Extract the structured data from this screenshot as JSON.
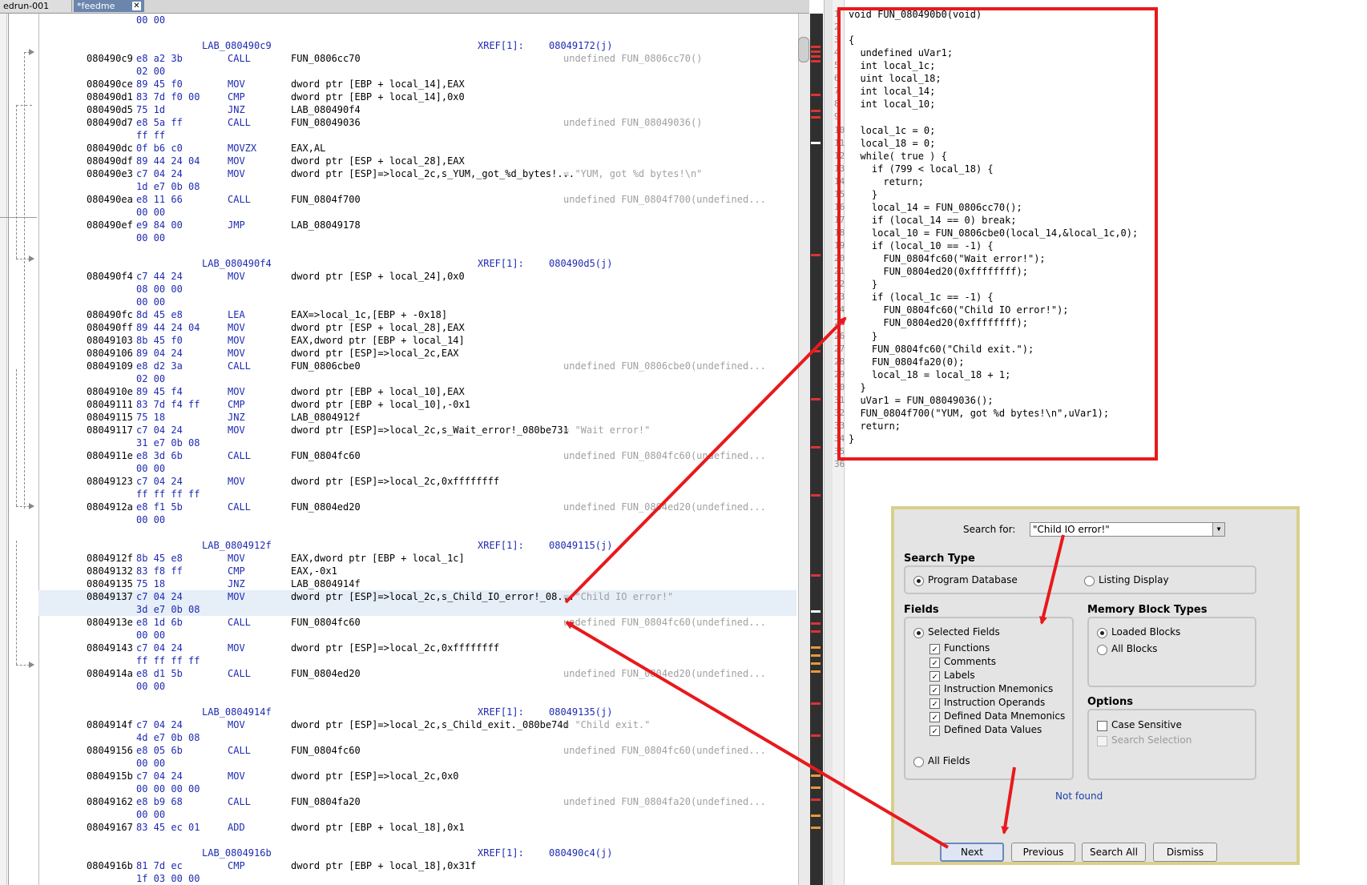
{
  "tabs": [
    {
      "label": "edrun-001"
    },
    {
      "label": "*feedme"
    }
  ],
  "listing": {
    "rows": [
      {
        "t": "cont",
        "bytes": "00 00"
      },
      {
        "t": "blank"
      },
      {
        "t": "label",
        "label": "LAB_080490c9",
        "xref": "XREF[1]:",
        "xaddr": "08049172(j)"
      },
      {
        "t": "ins",
        "addr": "080490c9",
        "bytes": "e8 a2 3b",
        "mn": "CALL",
        "ops": "FUN_0806cc70",
        "cmt": "undefined FUN_0806cc70()"
      },
      {
        "t": "cont",
        "bytes": "02 00"
      },
      {
        "t": "ins",
        "addr": "080490ce",
        "bytes": "89 45 f0",
        "mn": "MOV",
        "ops": "dword ptr [EBP + local_14],EAX",
        "cmt": ""
      },
      {
        "t": "ins",
        "addr": "080490d1",
        "bytes": "83 7d f0 00",
        "mn": "CMP",
        "ops": "dword ptr [EBP + local_14],0x0",
        "cmt": ""
      },
      {
        "t": "ins",
        "addr": "080490d5",
        "bytes": "75 1d",
        "mn": "JNZ",
        "ops": "LAB_080490f4",
        "cmt": ""
      },
      {
        "t": "ins",
        "addr": "080490d7",
        "bytes": "e8 5a ff",
        "mn": "CALL",
        "ops": "FUN_08049036",
        "cmt": "undefined FUN_08049036()"
      },
      {
        "t": "cont",
        "bytes": "ff ff"
      },
      {
        "t": "ins",
        "addr": "080490dc",
        "bytes": "0f b6 c0",
        "mn": "MOVZX",
        "ops": "EAX,AL",
        "cmt": ""
      },
      {
        "t": "ins",
        "addr": "080490df",
        "bytes": "89 44 24 04",
        "mn": "MOV",
        "ops": "dword ptr [ESP + local_28],EAX",
        "cmt": ""
      },
      {
        "t": "ins",
        "addr": "080490e3",
        "bytes": "c7 04 24",
        "mn": "MOV",
        "ops": "dword ptr [ESP]=>local_2c,s_YUM,_got_%d_bytes!...",
        "cmt": "= \"YUM, got %d bytes!\\n\""
      },
      {
        "t": "cont",
        "bytes": "1d e7 0b 08"
      },
      {
        "t": "ins",
        "addr": "080490ea",
        "bytes": "e8 11 66",
        "mn": "CALL",
        "ops": "FUN_0804f700",
        "cmt": "undefined FUN_0804f700(undefined..."
      },
      {
        "t": "cont",
        "bytes": "00 00"
      },
      {
        "t": "ins",
        "addr": "080490ef",
        "bytes": "e9 84 00",
        "mn": "JMP",
        "ops": "LAB_08049178",
        "cmt": ""
      },
      {
        "t": "cont",
        "bytes": "00 00"
      },
      {
        "t": "blank"
      },
      {
        "t": "label",
        "label": "LAB_080490f4",
        "xref": "XREF[1]:",
        "xaddr": "080490d5(j)"
      },
      {
        "t": "ins",
        "addr": "080490f4",
        "bytes": "c7 44 24",
        "mn": "MOV",
        "ops": "dword ptr [ESP + local_24],0x0",
        "cmt": ""
      },
      {
        "t": "cont",
        "bytes": "08 00 00"
      },
      {
        "t": "cont",
        "bytes": "00 00"
      },
      {
        "t": "ins",
        "addr": "080490fc",
        "bytes": "8d 45 e8",
        "mn": "LEA",
        "ops": "EAX=>local_1c,[EBP + -0x18]",
        "cmt": ""
      },
      {
        "t": "ins",
        "addr": "080490ff",
        "bytes": "89 44 24 04",
        "mn": "MOV",
        "ops": "dword ptr [ESP + local_28],EAX",
        "cmt": ""
      },
      {
        "t": "ins",
        "addr": "08049103",
        "bytes": "8b 45 f0",
        "mn": "MOV",
        "ops": "EAX,dword ptr [EBP + local_14]",
        "cmt": ""
      },
      {
        "t": "ins",
        "addr": "08049106",
        "bytes": "89 04 24",
        "mn": "MOV",
        "ops": "dword ptr [ESP]=>local_2c,EAX",
        "cmt": ""
      },
      {
        "t": "ins",
        "addr": "08049109",
        "bytes": "e8 d2 3a",
        "mn": "CALL",
        "ops": "FUN_0806cbe0",
        "cmt": "undefined FUN_0806cbe0(undefined..."
      },
      {
        "t": "cont",
        "bytes": "02 00"
      },
      {
        "t": "ins",
        "addr": "0804910e",
        "bytes": "89 45 f4",
        "mn": "MOV",
        "ops": "dword ptr [EBP + local_10],EAX",
        "cmt": ""
      },
      {
        "t": "ins",
        "addr": "08049111",
        "bytes": "83 7d f4 ff",
        "mn": "CMP",
        "ops": "dword ptr [EBP + local_10],-0x1",
        "cmt": ""
      },
      {
        "t": "ins",
        "addr": "08049115",
        "bytes": "75 18",
        "mn": "JNZ",
        "ops": "LAB_0804912f",
        "cmt": ""
      },
      {
        "t": "ins",
        "addr": "08049117",
        "bytes": "c7 04 24",
        "mn": "MOV",
        "ops": "dword ptr [ESP]=>local_2c,s_Wait_error!_080be731",
        "cmt": "= \"Wait error!\""
      },
      {
        "t": "cont",
        "bytes": "31 e7 0b 08"
      },
      {
        "t": "ins",
        "addr": "0804911e",
        "bytes": "e8 3d 6b",
        "mn": "CALL",
        "ops": "FUN_0804fc60",
        "cmt": "undefined FUN_0804fc60(undefined..."
      },
      {
        "t": "cont",
        "bytes": "00 00"
      },
      {
        "t": "ins",
        "addr": "08049123",
        "bytes": "c7 04 24",
        "mn": "MOV",
        "ops": "dword ptr [ESP]=>local_2c,0xffffffff",
        "cmt": ""
      },
      {
        "t": "cont",
        "bytes": "ff ff ff ff"
      },
      {
        "t": "ins",
        "addr": "0804912a",
        "bytes": "e8 f1 5b",
        "mn": "CALL",
        "ops": "FUN_0804ed20",
        "cmt": "undefined FUN_0804ed20(undefined..."
      },
      {
        "t": "cont",
        "bytes": "00 00"
      },
      {
        "t": "blank"
      },
      {
        "t": "label",
        "label": "LAB_0804912f",
        "xref": "XREF[1]:",
        "xaddr": "08049115(j)"
      },
      {
        "t": "ins",
        "addr": "0804912f",
        "bytes": "8b 45 e8",
        "mn": "MOV",
        "ops": "EAX,dword ptr [EBP + local_1c]",
        "cmt": ""
      },
      {
        "t": "ins",
        "addr": "08049132",
        "bytes": "83 f8 ff",
        "mn": "CMP",
        "ops": "EAX,-0x1",
        "cmt": ""
      },
      {
        "t": "ins",
        "addr": "08049135",
        "bytes": "75 18",
        "mn": "JNZ",
        "ops": "LAB_0804914f",
        "cmt": ""
      },
      {
        "t": "ins",
        "addr": "08049137",
        "bytes": "c7 04 24",
        "mn": "MOV",
        "ops": "dword ptr [ESP]=>local_2c,s_Child_IO_error!_08...",
        "cmt": "= \"Child IO error!\"",
        "hl": true
      },
      {
        "t": "cont",
        "bytes": "3d e7 0b 08"
      },
      {
        "t": "ins",
        "addr": "0804913e",
        "bytes": "e8 1d 6b",
        "mn": "CALL",
        "ops": "FUN_0804fc60",
        "cmt": "undefined FUN_0804fc60(undefined..."
      },
      {
        "t": "cont",
        "bytes": "00 00"
      },
      {
        "t": "ins",
        "addr": "08049143",
        "bytes": "c7 04 24",
        "mn": "MOV",
        "ops": "dword ptr [ESP]=>local_2c,0xffffffff",
        "cmt": ""
      },
      {
        "t": "cont",
        "bytes": "ff ff ff ff"
      },
      {
        "t": "ins",
        "addr": "0804914a",
        "bytes": "e8 d1 5b",
        "mn": "CALL",
        "ops": "FUN_0804ed20",
        "cmt": "undefined FUN_0804ed20(undefined..."
      },
      {
        "t": "cont",
        "bytes": "00 00"
      },
      {
        "t": "blank"
      },
      {
        "t": "label",
        "label": "LAB_0804914f",
        "xref": "XREF[1]:",
        "xaddr": "08049135(j)"
      },
      {
        "t": "ins",
        "addr": "0804914f",
        "bytes": "c7 04 24",
        "mn": "MOV",
        "ops": "dword ptr [ESP]=>local_2c,s_Child_exit._080be74d",
        "cmt": "= \"Child exit.\""
      },
      {
        "t": "cont",
        "bytes": "4d e7 0b 08"
      },
      {
        "t": "ins",
        "addr": "08049156",
        "bytes": "e8 05 6b",
        "mn": "CALL",
        "ops": "FUN_0804fc60",
        "cmt": "undefined FUN_0804fc60(undefined..."
      },
      {
        "t": "cont",
        "bytes": "00 00"
      },
      {
        "t": "ins",
        "addr": "0804915b",
        "bytes": "c7 04 24",
        "mn": "MOV",
        "ops": "dword ptr [ESP]=>local_2c,0x0",
        "cmt": ""
      },
      {
        "t": "cont",
        "bytes": "00 00 00 00"
      },
      {
        "t": "ins",
        "addr": "08049162",
        "bytes": "e8 b9 68",
        "mn": "CALL",
        "ops": "FUN_0804fa20",
        "cmt": "undefined FUN_0804fa20(undefined..."
      },
      {
        "t": "cont",
        "bytes": "00 00"
      },
      {
        "t": "ins",
        "addr": "08049167",
        "bytes": "83 45 ec 01",
        "mn": "ADD",
        "ops": "dword ptr [EBP + local_18],0x1",
        "cmt": ""
      },
      {
        "t": "blank"
      },
      {
        "t": "label",
        "label": "LAB_0804916b",
        "xref": "XREF[1]:",
        "xaddr": "080490c4(j)"
      },
      {
        "t": "ins",
        "addr": "0804916b",
        "bytes": "81 7d ec",
        "mn": "CMP",
        "ops": "dword ptr [EBP + local_18],0x31f",
        "cmt": ""
      },
      {
        "t": "cont",
        "bytes": "1f 03 00 00"
      }
    ]
  },
  "decompiler": {
    "lines": [
      {
        "n": "1",
        "code": "void FUN_080490b0(void)"
      },
      {
        "n": "2",
        "code": ""
      },
      {
        "n": "3",
        "code": "{"
      },
      {
        "n": "4",
        "code": "  undefined uVar1;"
      },
      {
        "n": "5",
        "code": "  int local_1c;"
      },
      {
        "n": "6",
        "code": "  uint local_18;"
      },
      {
        "n": "7",
        "code": "  int local_14;"
      },
      {
        "n": "8",
        "code": "  int local_10;"
      },
      {
        "n": "9",
        "code": ""
      },
      {
        "n": "10",
        "code": "  local_1c = 0;"
      },
      {
        "n": "11",
        "code": "  local_18 = 0;"
      },
      {
        "n": "12",
        "code": "  while( true ) {"
      },
      {
        "n": "13",
        "code": "    if (799 < local_18) {"
      },
      {
        "n": "14",
        "code": "      return;"
      },
      {
        "n": "15",
        "code": "    }"
      },
      {
        "n": "16",
        "code": "    local_14 = FUN_0806cc70();"
      },
      {
        "n": "17",
        "code": "    if (local_14 == 0) break;"
      },
      {
        "n": "18",
        "code": "    local_10 = FUN_0806cbe0(local_14,&local_1c,0);"
      },
      {
        "n": "19",
        "code": "    if (local_10 == -1) {"
      },
      {
        "n": "20",
        "code": "      FUN_0804fc60(\"Wait error!\");"
      },
      {
        "n": "21",
        "code": "      FUN_0804ed20(0xffffffff);"
      },
      {
        "n": "22",
        "code": "    }"
      },
      {
        "n": "23",
        "code": "    if (local_1c == -1) {"
      },
      {
        "n": "24",
        "code": "      FUN_0804fc60(\"Child IO error!\");"
      },
      {
        "n": "25",
        "code": "      FUN_0804ed20(0xffffffff);"
      },
      {
        "n": "26",
        "code": "    }"
      },
      {
        "n": "27",
        "code": "    FUN_0804fc60(\"Child exit.\");"
      },
      {
        "n": "28",
        "code": "    FUN_0804fa20(0);"
      },
      {
        "n": "29",
        "code": "    local_18 = local_18 + 1;"
      },
      {
        "n": "30",
        "code": "  }"
      },
      {
        "n": "31",
        "code": "  uVar1 = FUN_08049036();"
      },
      {
        "n": "32",
        "code": "  FUN_0804f700(\"YUM, got %d bytes!\\n\",uVar1);"
      },
      {
        "n": "33",
        "code": "  return;"
      },
      {
        "n": "34",
        "code": "}"
      },
      {
        "n": "35",
        "code": ""
      },
      {
        "n": "36",
        "code": ""
      }
    ]
  },
  "search_dialog": {
    "search_for_label": "Search for:",
    "search_value": "\"Child IO error!\"",
    "search_type_title": "Search Type",
    "search_type_options": [
      {
        "label": "Program Database",
        "selected": true
      },
      {
        "label": "Listing Display",
        "selected": false
      }
    ],
    "fields_title": "Fields",
    "selected_fields_label": "Selected Fields",
    "field_items": [
      {
        "label": "Functions",
        "checked": true
      },
      {
        "label": "Comments",
        "checked": true
      },
      {
        "label": "Labels",
        "checked": true
      },
      {
        "label": "Instruction Mnemonics",
        "checked": true
      },
      {
        "label": "Instruction Operands",
        "checked": true
      },
      {
        "label": "Defined Data Mnemonics",
        "checked": true
      },
      {
        "label": "Defined Data Values",
        "checked": true
      }
    ],
    "all_fields_label": "All Fields",
    "memory_title": "Memory Block Types",
    "memory_options": [
      {
        "label": "Loaded Blocks",
        "selected": true
      },
      {
        "label": "All Blocks",
        "selected": false
      }
    ],
    "options_title": "Options",
    "option_items": [
      {
        "label": "Case Sensitive",
        "checked": false,
        "disabled": false
      },
      {
        "label": "Search Selection",
        "checked": false,
        "disabled": true
      }
    ],
    "status": "Not found",
    "buttons": {
      "next": "Next",
      "previous": "Previous",
      "search_all": "Search All",
      "dismiss": "Dismiss"
    }
  },
  "colors": {
    "annotation": "#e8191c",
    "status": "#1f3fa8",
    "dialog_border": "#d9cf8c"
  }
}
